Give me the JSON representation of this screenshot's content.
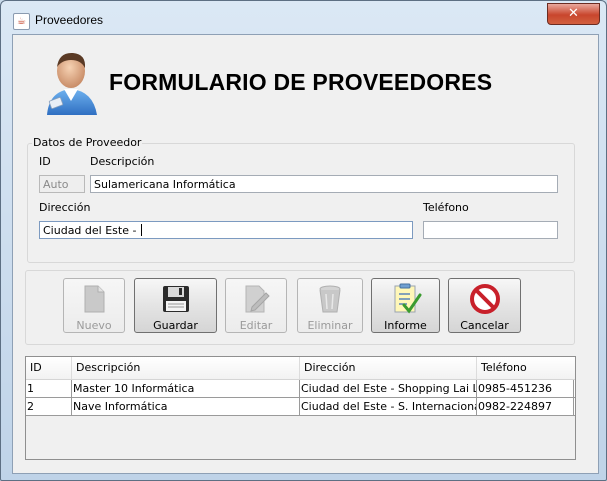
{
  "window": {
    "title": "Proveedores",
    "close_glyph": "✕"
  },
  "form": {
    "heading": "FORMULARIO DE PROVEEDORES",
    "group_title": "Datos de Proveedor",
    "labels": {
      "id": "ID",
      "descripcion": "Descripción",
      "direccion": "Dirección",
      "telefono": "Teléfono"
    },
    "values": {
      "id": "Auto",
      "descripcion": "Sulamericana Informática",
      "direccion": "Ciudad del Este - ",
      "telefono": ""
    }
  },
  "toolbar": {
    "nuevo": "Nuevo",
    "guardar": "Guardar",
    "editar": "Editar",
    "eliminar": "Eliminar",
    "informe": "Informe",
    "cancelar": "Cancelar"
  },
  "table": {
    "columns": [
      "ID",
      "Descripción",
      "Dirección",
      "Teléfono"
    ],
    "rows": [
      [
        "1",
        "Master 10 Informática",
        "Ciudad del Este - Shopping Lai Lai",
        "0985-451236"
      ],
      [
        "2",
        "Nave Informática",
        "Ciudad del Este - S. Internacional",
        "0982-224897"
      ]
    ]
  },
  "icons": {
    "app": "java-icon",
    "avatar": "user-avatar-icon",
    "nuevo": "new-document-icon",
    "guardar": "floppy-disk-icon",
    "editar": "edit-pencil-icon",
    "eliminar": "trash-can-icon",
    "informe": "report-checklist-icon",
    "cancelar": "cancel-no-icon"
  },
  "colors": {
    "accent_red": "#c8202a",
    "title_bar": "#c9daea",
    "close_red": "#c8462d"
  }
}
